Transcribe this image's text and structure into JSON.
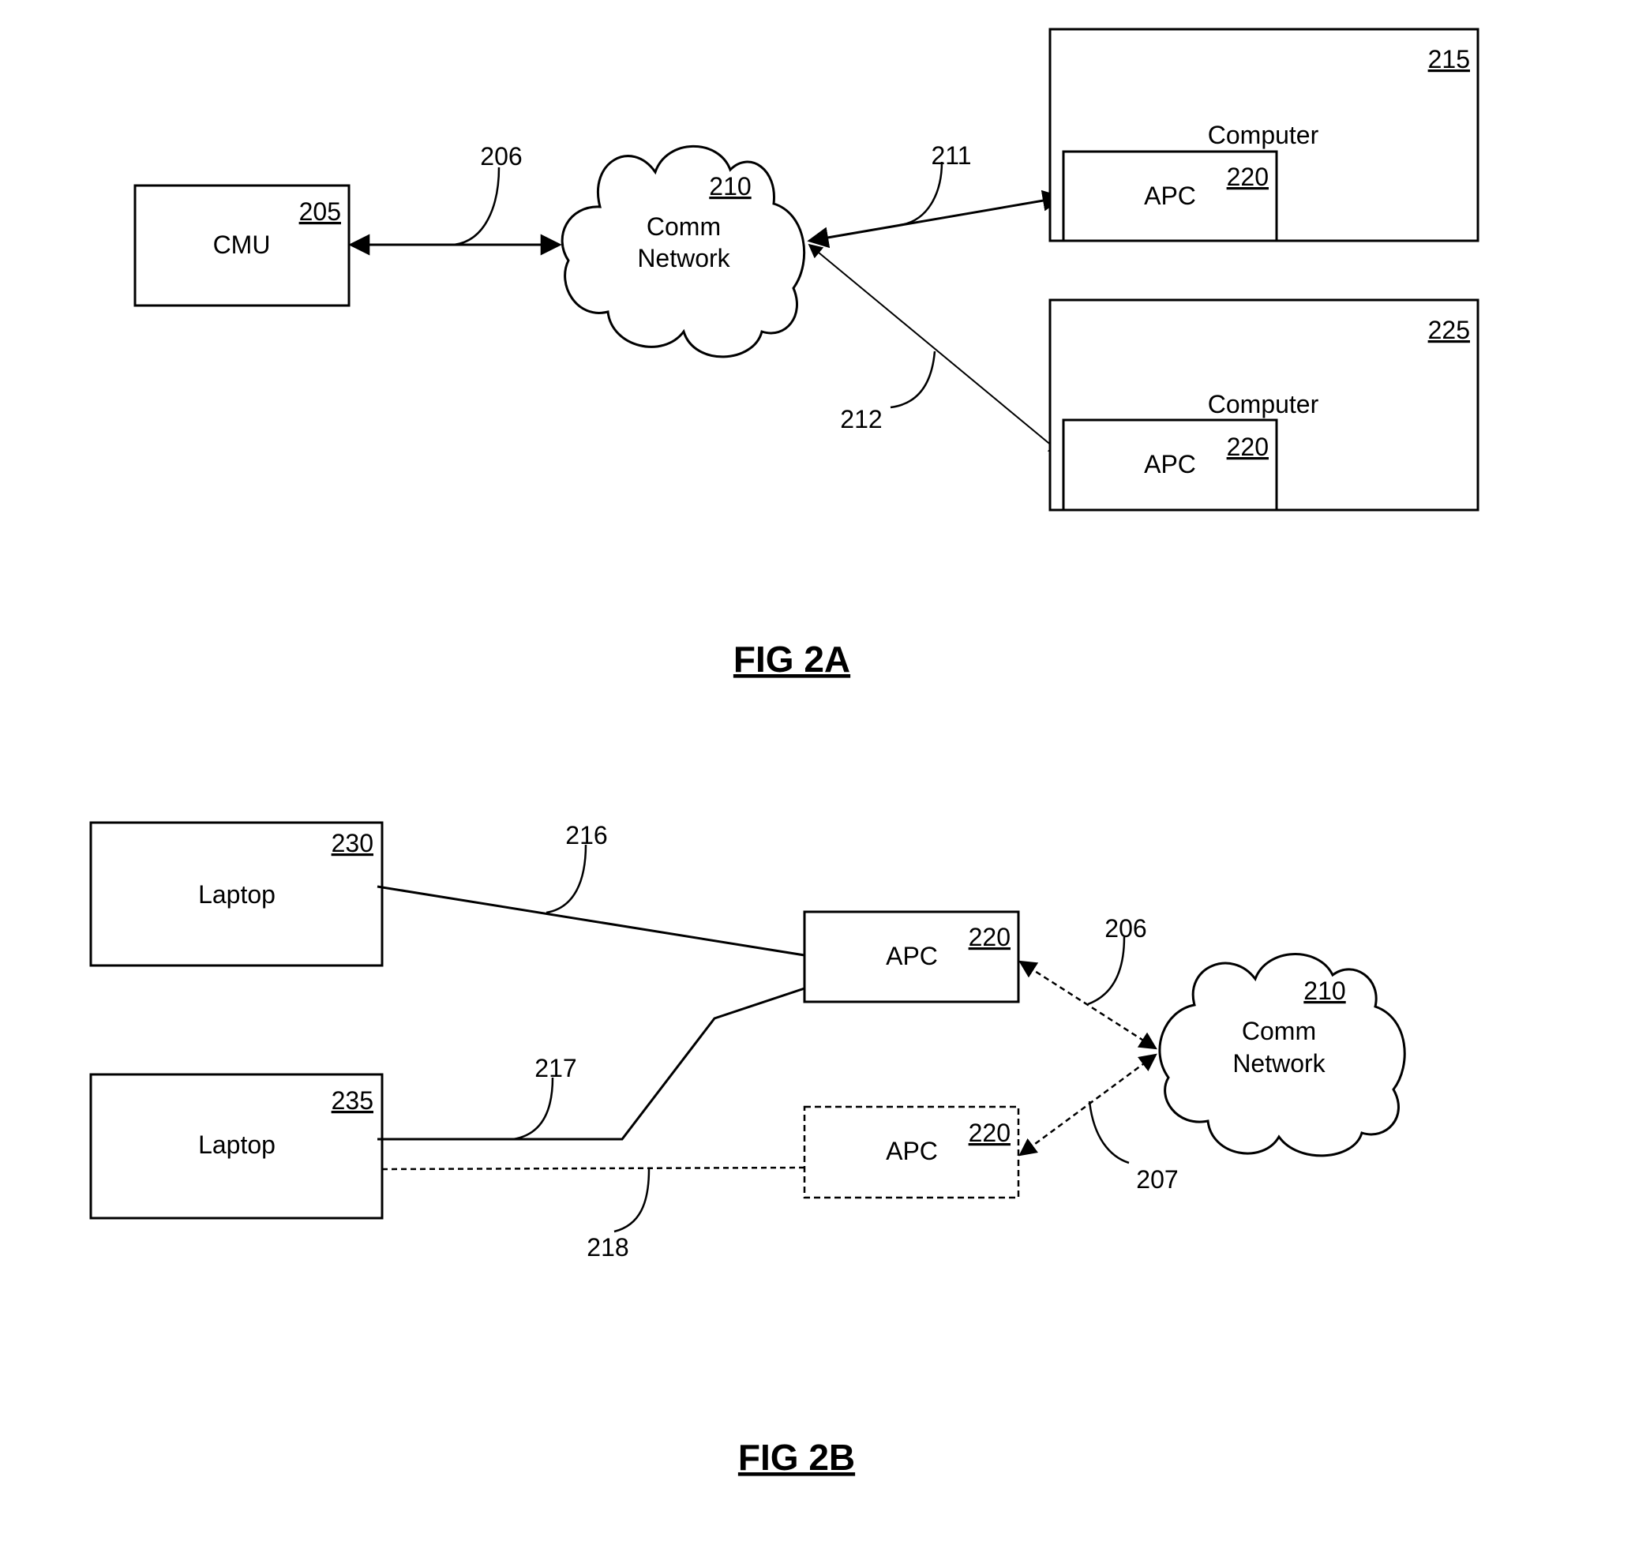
{
  "fig2a": {
    "title": "FIG 2A",
    "cmu": {
      "label": "CMU",
      "ref": "205"
    },
    "network": {
      "line1": "Comm",
      "line2": "Network",
      "ref": "210"
    },
    "computer1": {
      "label": "Computer",
      "ref": "215",
      "apc": {
        "label": "APC",
        "ref": "220"
      }
    },
    "computer2": {
      "label": "Computer",
      "ref": "225",
      "apc": {
        "label": "APC",
        "ref": "220"
      }
    },
    "links": {
      "cmu_network": "206",
      "network_computer1": "211",
      "network_computer2": "212"
    }
  },
  "fig2b": {
    "title": "FIG 2B",
    "laptop1": {
      "label": "Laptop",
      "ref": "230"
    },
    "laptop2": {
      "label": "Laptop",
      "ref": "235"
    },
    "apc_primary": {
      "label": "APC",
      "ref": "220"
    },
    "apc_optional": {
      "label": "APC",
      "ref": "220"
    },
    "network": {
      "line1": "Comm",
      "line2": "Network",
      "ref": "210"
    },
    "links": {
      "laptop1_apc": "216",
      "laptop2_apc": "217",
      "laptop2_apc_optional": "218",
      "apc_network": "206",
      "apc_optional_network": "207"
    }
  }
}
